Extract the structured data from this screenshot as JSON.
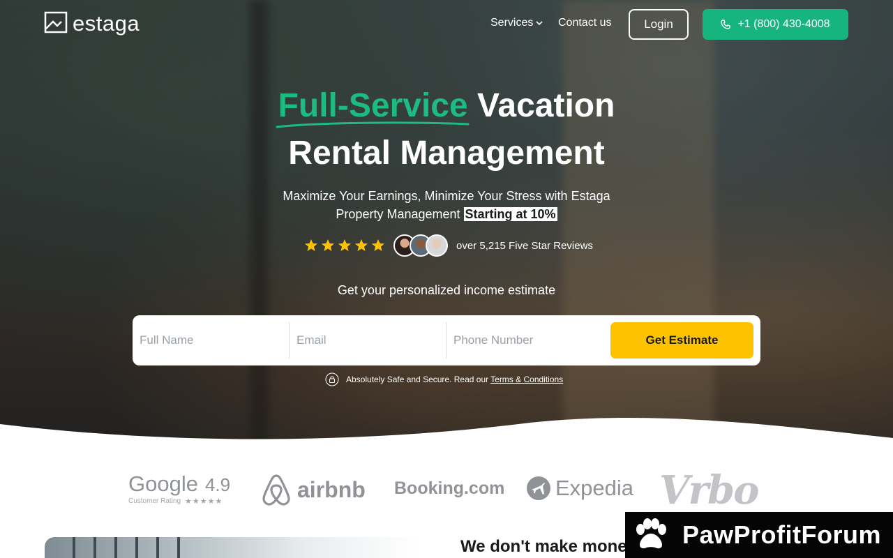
{
  "brand": {
    "name": "estaga"
  },
  "nav": {
    "services_label": "Services",
    "contact_label": "Contact us",
    "login_label": "Login",
    "phone_label": "+1 (800) 430-4008"
  },
  "hero": {
    "headline_accent": "Full-Service",
    "headline_rest_line1": " Vacation",
    "headline_line2": "Rental Management",
    "subhead_line1": "Maximize Your Earnings, Minimize Your Stress with Estaga",
    "subhead_line2": "Property Management ",
    "subhead_highlight": "Starting at 10%",
    "star_count": 5,
    "reviews_text": "over 5,215 Five Star Reviews",
    "estimate_title": "Get your personalized income estimate"
  },
  "form": {
    "name_placeholder": "Full Name",
    "email_placeholder": "Email",
    "phone_placeholder": "Phone Number",
    "submit_label": "Get Estimate"
  },
  "secure": {
    "text": "Absolutely Safe and Secure. Read our",
    "terms_link": "Terms & Conditions"
  },
  "platforms": {
    "google_word": "Google",
    "google_rating": "4.9",
    "google_sub": "Customer Rating",
    "airbnb": "airbnb",
    "booking": "Booking.com",
    "expedia": "Expedia",
    "vrbo": "Vrbo"
  },
  "section": {
    "heading": "We don't make mone"
  },
  "watermark": {
    "text": "PawProfitForum"
  },
  "colors": {
    "accent_green": "#1dbb82",
    "phone_button": "#16b57f",
    "cta_yellow": "#fdc300"
  }
}
